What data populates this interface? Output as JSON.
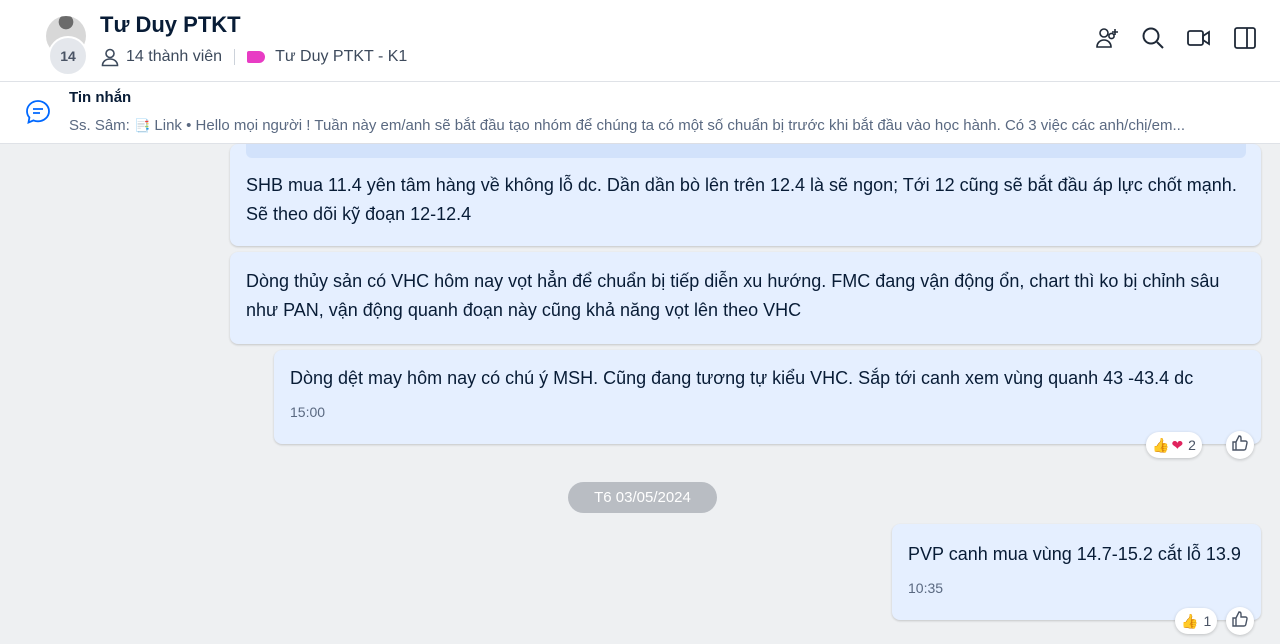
{
  "header": {
    "group_name": "Tư Duy PTKT",
    "avatar_count": "14",
    "members_label": "14 thành viên",
    "community_tag": "Tư Duy PTKT - K1",
    "icons": [
      "add-member-icon",
      "search-icon",
      "video-call-icon",
      "sidebar-toggle-icon"
    ]
  },
  "pinned": {
    "title": "Tin nhắn",
    "sender": "Ss. Sâm:",
    "emoji": "📑",
    "link_label": "Link",
    "preview": "Hello mọi người ! Tuần này em/anh sẽ bắt đầu tạo nhóm để chúng ta có một số chuẩn bị trước khi bắt đầu vào học hành. Có 3 việc các anh/chị/em..."
  },
  "messages": [
    {
      "text": "SHB mua 11.4 yên tâm hàng về không lỗ dc. Dần dần bò lên trên 12.4 là sẽ ngon; Tới 12 cũng sẽ bắt đầu áp lực chốt mạnh. Sẽ theo dõi kỹ đoạn 12-12.4"
    },
    {
      "text": "Dòng thủy sản có VHC hôm nay vọt hẳn để chuẩn bị tiếp diễn xu hướng. FMC đang vận động ổn, chart thì ko bị chỉnh sâu như PAN, vận động quanh đoạn này cũng khả năng vọt lên theo VHC"
    },
    {
      "text": "Dòng dệt may hôm nay có chú ý MSH. Cũng đang tương tự kiểu VHC. Sắp tới canh xem vùng quanh 43 -43.4 dc",
      "time": "15:00",
      "reaction_count": "2"
    },
    {
      "text": "PVP canh mua vùng 14.7-15.2 cắt lỗ 13.9",
      "time": "10:35",
      "reaction_count": "1"
    }
  ],
  "date_divider": "T6 03/05/2024",
  "colors": {
    "bubble": "#e5efff",
    "tag": "#e83cc4",
    "date_pill": "#b9bdc3"
  }
}
